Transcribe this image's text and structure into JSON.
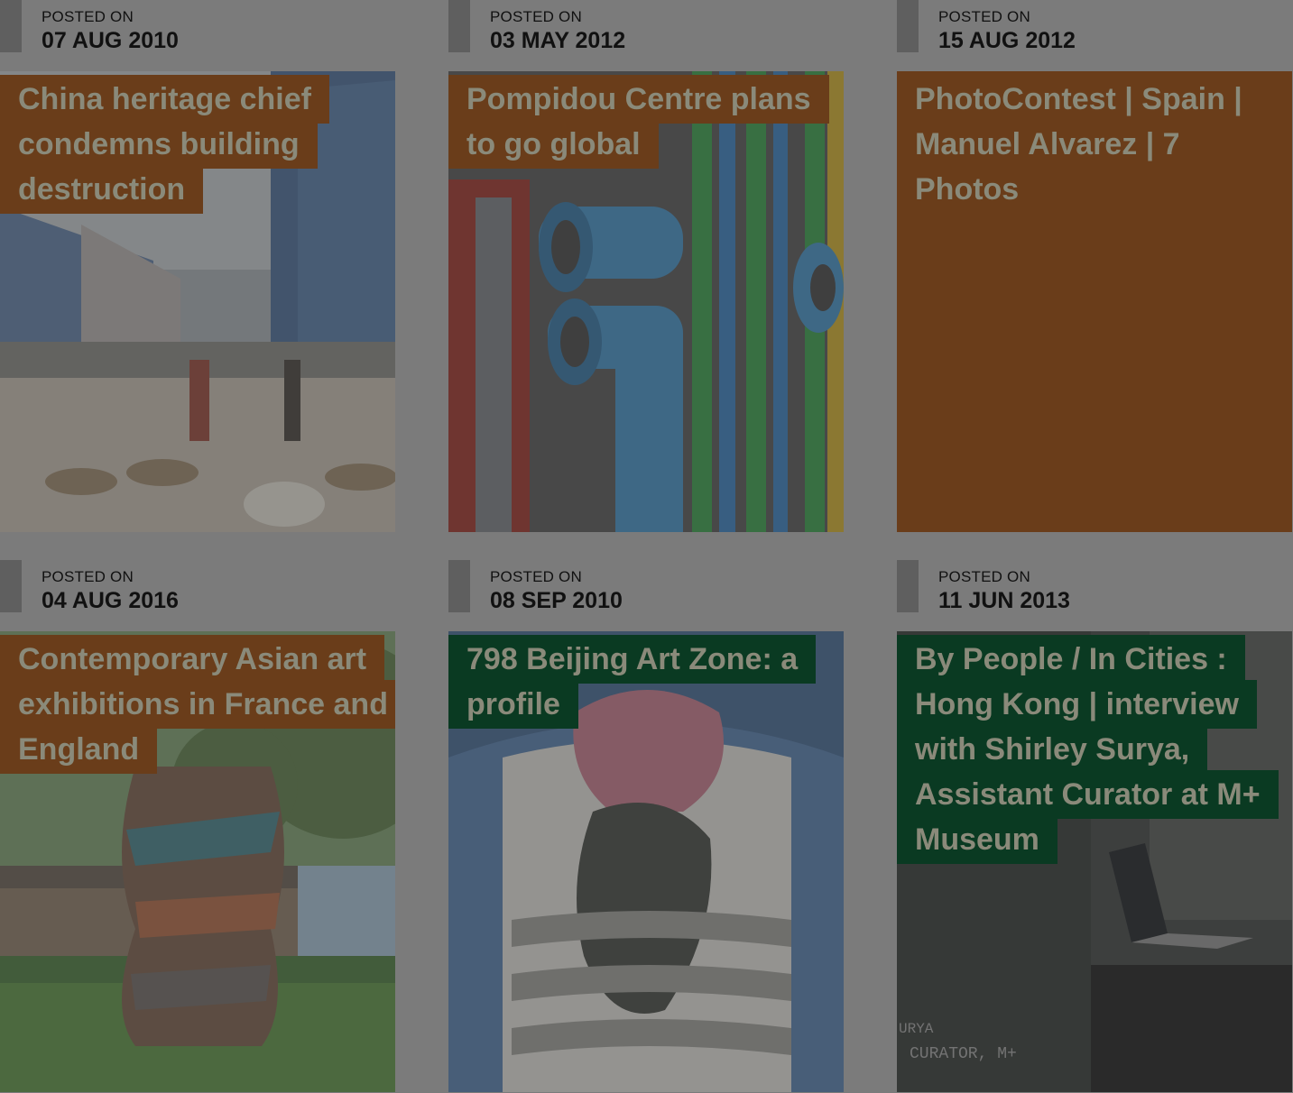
{
  "posts": [
    {
      "posted_label": "POSTED ON",
      "date": "07 AUG 2010",
      "title": "China heritage chief condemns building destruction",
      "style": "brown",
      "image": "street-demolition-goats-photo"
    },
    {
      "posted_label": "POSTED ON",
      "date": "03 MAY 2012",
      "title": "Pompidou Centre plans to go global",
      "style": "brown",
      "image": "pompidou-pipes-photo"
    },
    {
      "posted_label": "POSTED ON",
      "date": "15 AUG 2012",
      "title": "PhotoContest | Spain | Manuel Alvarez | 7 Photos",
      "style": "brown-plain",
      "image": ""
    },
    {
      "posted_label": "POSTED ON",
      "date": "04 AUG 2016",
      "title": "Contemporary Asian art exhibitions in France and England",
      "style": "brown",
      "image": "sculpture-lawn-photo"
    },
    {
      "posted_label": "POSTED ON",
      "date": "08 SEP 2010",
      "title": "798 Beijing Art Zone: a profile",
      "style": "green",
      "image": "graffiti-artwork-photo"
    },
    {
      "posted_label": "POSTED ON",
      "date": "11 JUN 2013",
      "title": "By People / In Cities : Hong Kong | interview with Shirley Surya, Assistant Curator at M+ Museum",
      "style": "green",
      "image": "laptop-window-photo",
      "image_caption_line1": "URYA",
      "image_caption_line2": "CURATOR, M+"
    }
  ],
  "colors": {
    "overlay": "#7b7b7b",
    "brown": "#6a3d1a",
    "green": "#0a3a22"
  }
}
